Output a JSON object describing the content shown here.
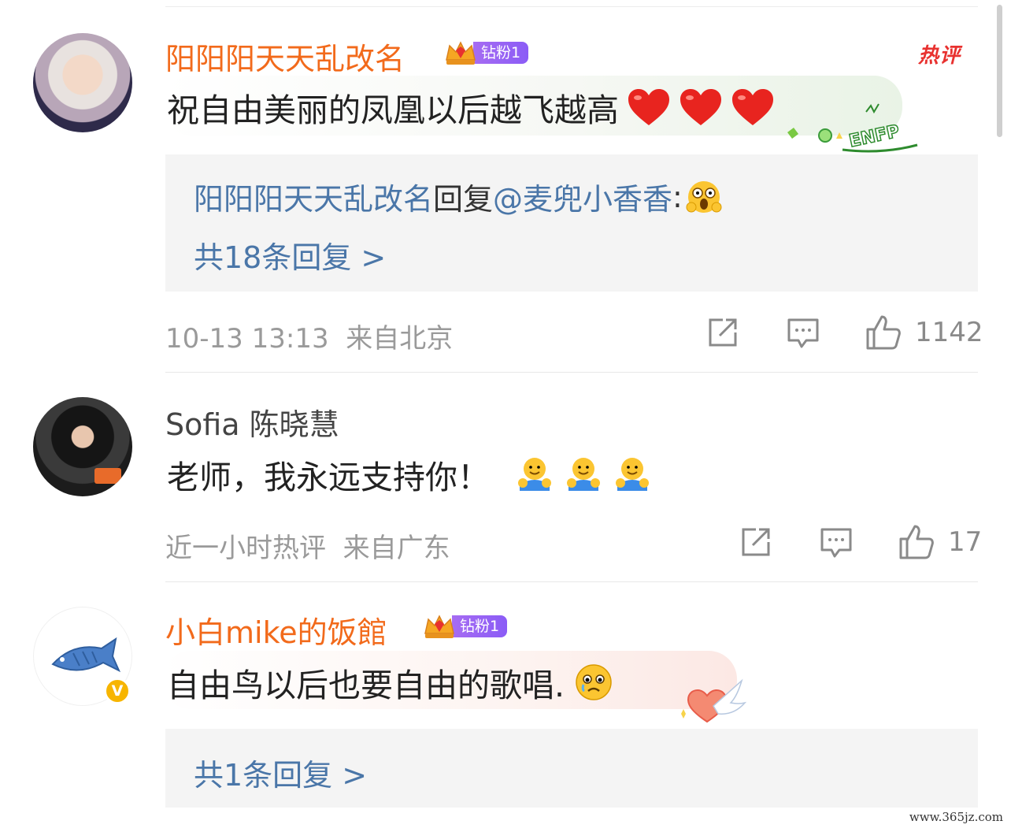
{
  "colors": {
    "username_orange": "#f26a1b",
    "reply_blue": "#4a76a8",
    "meta_gray": "#9a9a9a",
    "fan_badge_purple": "#8b5cf6",
    "hot_red": "#e8312f"
  },
  "comments": [
    {
      "username": "阳阳阳天天乱改名",
      "fan_badge": "钻粉1",
      "hot_label": "热评",
      "text": "祝自由美丽的凤凰以后越飞越高",
      "emojis": [
        "heart",
        "heart",
        "heart"
      ],
      "bubble_sticker": "ENFP",
      "reply_preview": {
        "user": "阳阳阳天天乱改名",
        "action": "回复",
        "mention": "@麦兜小香香",
        "suffix": ":"
      },
      "reply_count": "共18条回复 >",
      "timestamp": "10-13 13:13",
      "location": "来自北京",
      "likes": "1142"
    },
    {
      "username": "Sofia 陈晓慧",
      "text": "老师，我永远支持你！",
      "emojis": [
        "hug",
        "hug",
        "hug"
      ],
      "timestamp": "近一小时热评",
      "location": "来自广东",
      "likes": "17"
    },
    {
      "username": "小白mike的饭館",
      "fan_badge": "钻粉1",
      "verified_badge": "V",
      "text": "自由鸟以后也要自由的歌唱.",
      "emojis": [
        "crying-face"
      ],
      "reply_count": "共1条回复 >"
    }
  ],
  "watermark": "www.365jz.com"
}
